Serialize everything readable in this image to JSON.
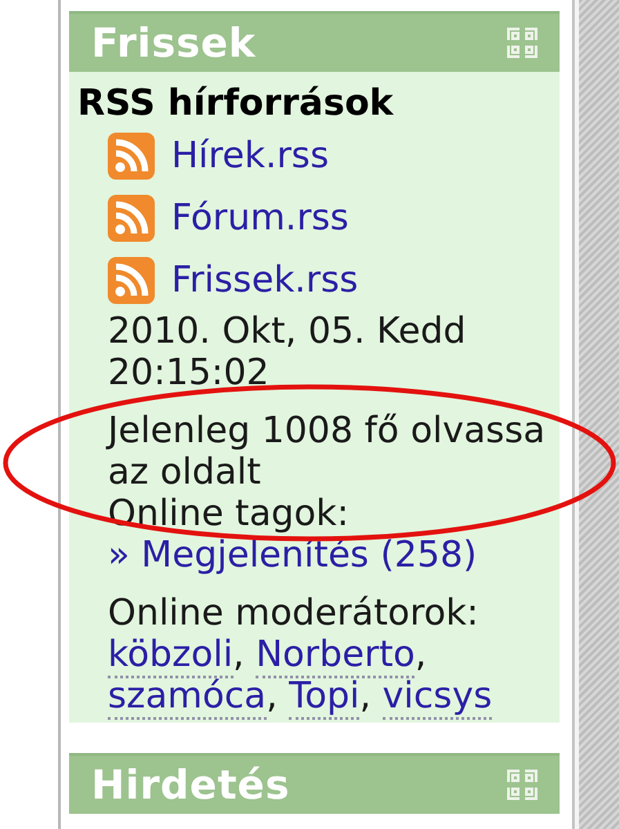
{
  "panels": [
    {
      "title": "Frissek",
      "section_title": "RSS hírforrások",
      "feeds": [
        {
          "label": "Hírek.rss"
        },
        {
          "label": "Fórum.rss"
        },
        {
          "label": "Frissek.rss"
        }
      ],
      "datetime": "2010. Okt, 05. Kedd 20:15:02",
      "readers": "Jelenleg 1008 fő olvassa az oldalt",
      "members_label": "Online tagok:",
      "members_link": "» Megjelenítés (258)",
      "moderators_label": "Online moderátorok:",
      "moderators": [
        {
          "name": "köbzoli"
        },
        {
          "name": "Norberto"
        },
        {
          "name": "szamóca"
        },
        {
          "name": "Topi"
        },
        {
          "name": "vicsys"
        }
      ],
      "separator": ","
    },
    {
      "title": "Hirdetés"
    }
  ],
  "highlight": {
    "kind": "ellipse"
  }
}
